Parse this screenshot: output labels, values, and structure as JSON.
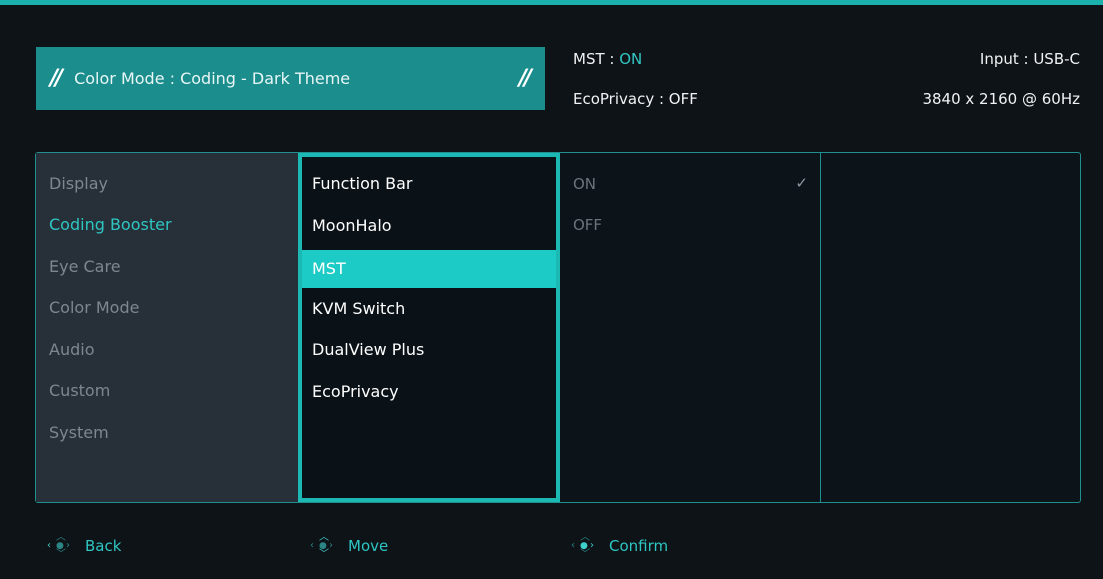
{
  "header": {
    "color_mode_text": "Color Mode : Coding - Dark Theme",
    "slash_glyph": "//",
    "mst_label": "MST :",
    "mst_value": "ON",
    "ecoprivacy": "EcoPrivacy : OFF",
    "input": "Input : USB-C",
    "resolution": "3840 x 2160 @ 60Hz"
  },
  "main_menu": {
    "items": [
      "Display",
      "Coding Booster",
      "Eye Care",
      "Color Mode",
      "Audio",
      "Custom",
      "System"
    ],
    "active": "Coding Booster"
  },
  "sub_menu": {
    "items": [
      "Function Bar",
      "MoonHalo",
      "MST",
      "KVM Switch",
      "DualView Plus",
      "EcoPrivacy"
    ],
    "selected": "MST"
  },
  "options": {
    "items": [
      "ON",
      "OFF"
    ],
    "checked": "ON",
    "check_glyph": "✓"
  },
  "footer": {
    "back": "Back",
    "move": "Move",
    "confirm": "Confirm"
  },
  "colors": {
    "accent": "#1bb1ad",
    "banner": "#1b8d8d",
    "background": "#0e1318",
    "main_column": "#273038"
  }
}
